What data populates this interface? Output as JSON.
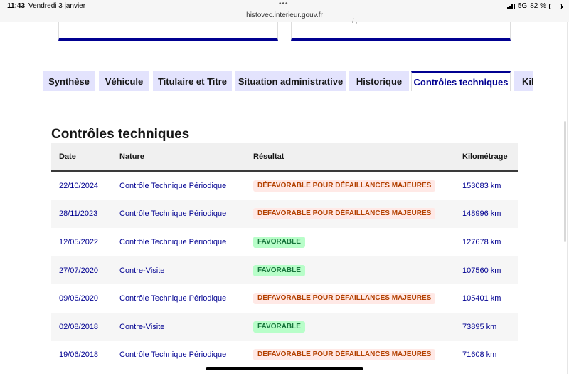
{
  "status_bar": {
    "time": "11:43",
    "date": "Vendredi 3 janvier",
    "dots": "•••",
    "url": "histovec.interieur.gouv.fr",
    "network": "5G",
    "battery": "82 %",
    "battery_level": 0.82
  },
  "top_cards": {
    "card2_fragment": "/ ,"
  },
  "tabs": [
    {
      "label": "Synthèse",
      "active": false
    },
    {
      "label": "Véhicule",
      "active": false
    },
    {
      "label": "Titulaire et Titre",
      "active": false
    },
    {
      "label": "Situation administrative",
      "active": false
    },
    {
      "label": "Historique",
      "active": false
    },
    {
      "label": "Contrôles techniques",
      "active": true
    },
    {
      "label": "Kilo",
      "active": false
    }
  ],
  "section": {
    "title": "Contrôles techniques"
  },
  "table": {
    "headers": {
      "date": "Date",
      "nature": "Nature",
      "result": "Résultat",
      "mileage": "Kilométrage"
    },
    "rows": [
      {
        "date": "22/10/2024",
        "nature": "Contrôle Technique Périodique",
        "result": "DÉFAVORABLE POUR DÉFAILLANCES MAJEURES",
        "status": "bad",
        "mileage": "153083 km"
      },
      {
        "date": "28/11/2023",
        "nature": "Contrôle Technique Périodique",
        "result": "DÉFAVORABLE POUR DÉFAILLANCES MAJEURES",
        "status": "bad",
        "mileage": "148996 km"
      },
      {
        "date": "12/05/2022",
        "nature": "Contrôle Technique Périodique",
        "result": "FAVORABLE",
        "status": "good",
        "mileage": "127678 km"
      },
      {
        "date": "27/07/2020",
        "nature": "Contre-Visite",
        "result": "FAVORABLE",
        "status": "good",
        "mileage": "107560 km"
      },
      {
        "date": "09/06/2020",
        "nature": "Contrôle Technique Périodique",
        "result": "DÉFAVORABLE POUR DÉFAILLANCES MAJEURES",
        "status": "bad",
        "mileage": "105401 km"
      },
      {
        "date": "02/08/2018",
        "nature": "Contre-Visite",
        "result": "FAVORABLE",
        "status": "good",
        "mileage": "73895 km"
      },
      {
        "date": "19/06/2018",
        "nature": "Contrôle Technique Périodique",
        "result": "DÉFAVORABLE POUR DÉFAILLANCES MAJEURES",
        "status": "bad",
        "mileage": "71608 km"
      }
    ]
  },
  "colors": {
    "accent": "#000091",
    "bad_text": "#b34000",
    "bad_bg": "#ffe9e6",
    "good_text": "#18753c",
    "good_bg": "#b8fec9",
    "tab_bg": "#e3e3fd"
  }
}
